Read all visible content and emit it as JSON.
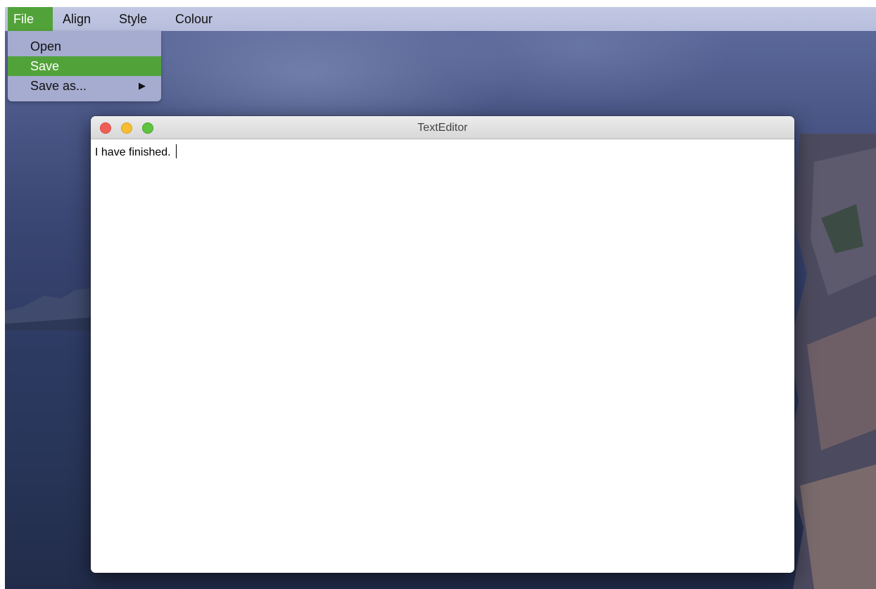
{
  "menubar": {
    "items": [
      {
        "label": "File",
        "active": true
      },
      {
        "label": "Align",
        "active": false
      },
      {
        "label": "Style",
        "active": false
      },
      {
        "label": "Colour",
        "active": false
      }
    ]
  },
  "file_menu": {
    "items": [
      {
        "label": "Open",
        "highlighted": false,
        "has_submenu": false
      },
      {
        "label": "Save",
        "highlighted": true,
        "has_submenu": false
      },
      {
        "label": "Save as...",
        "highlighted": false,
        "has_submenu": true,
        "submenu_icon": "triangle-right-icon"
      }
    ],
    "submenu_arrow_glyph": "▶"
  },
  "window": {
    "title": "TextEditor",
    "controls": [
      "close-icon",
      "minimize-icon",
      "maximize-icon"
    ],
    "content": "I have finished. "
  },
  "colors": {
    "accent_highlight": "#52a23a",
    "menubar_bg": "#b7bedc",
    "dropdown_bg": "#a6acd0",
    "traffic_close": "#ee5f59",
    "traffic_minimize": "#f6bd30",
    "traffic_maximize": "#5fc33f"
  }
}
